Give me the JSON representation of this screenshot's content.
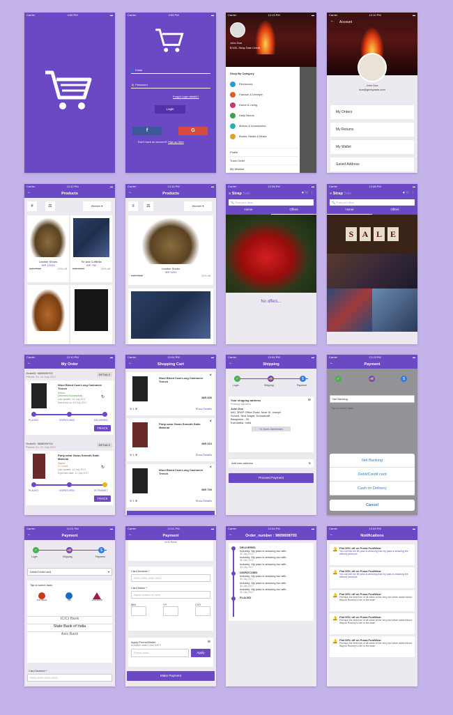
{
  "status": {
    "carrier": "Carrier",
    "time1": "4:55 PM",
    "time2": "12:10 PM",
    "time3": "12:08 PM",
    "time4": "12:13 PM",
    "time5": "12:09 PM",
    "time6": "12:04 PM",
    "time7": "12:01 PM"
  },
  "login": {
    "email": "Email",
    "password": "Password",
    "forgot": "Forgot Login details?",
    "login": "Login",
    "no_account": "Don't have an account?",
    "signup": "Sign up here",
    "fb": "f",
    "google": "G"
  },
  "drawer": {
    "user": "John Doe",
    "points": "$ 000, Strap Sale Credit",
    "section": "Shop By Category",
    "cats": [
      "Electronics",
      "Fashion & Lifestyle",
      "Home & Living",
      "Daily Needs",
      "Motors & Accessories",
      "Books, Media & Music"
    ],
    "links": [
      "Profile",
      "Track Order",
      "My Wishlist"
    ]
  },
  "account": {
    "title": "Account",
    "name": "John Doe",
    "email": "doe@geekyants.com",
    "items": [
      "My Orders",
      "My Returns",
      "My Wallet",
      "Saved Address"
    ]
  },
  "products": {
    "title": "Products",
    "filter": "Women",
    "p1_name": "Leather Shoes",
    "p1_price": "INR 12000",
    "p1_old": "INR 7560",
    "p1_off": "20% off",
    "p2_name": "Tie and Cufflinks",
    "p2_price": "INR 780",
    "p2_old": "INR 1200",
    "p2_off": "20% off",
    "l_name": "Leather Shoes",
    "l_price": "INR 5200",
    "l_old": "INR 7560",
    "l_off": "20% off"
  },
  "home": {
    "brand": "Strap",
    "brand2": "Sale",
    "search": "Find your deal",
    "tab1": "Home",
    "tab2": "Offers",
    "no_offers": "No offers...",
    "sale": [
      "S",
      "A",
      "L",
      "E"
    ]
  },
  "orders": {
    "title": "My Order",
    "o1_id": "OrderID: 9809500703",
    "o1_date": "Placed On: 14 July 2017",
    "details": "DETAILS",
    "o1_item": "Wool Blend Coat Long Cashmere Trench",
    "o1_status": "Status:",
    "o1_state": "Delivered Successfully",
    "o1_upd": "Last update: 14 July 2017",
    "o1_del": "Delivered on: 15 July 2017",
    "steps": [
      "PLACED",
      "DISPATCHED",
      "DELIVERED"
    ],
    "track": "TRACK",
    "o2_id": "OrderID: 9808009704",
    "o2_date": "Placed On: 10 July 2017",
    "o2_item": "Party-wear Gown Smooth Satin Material",
    "o2_state": "In Transit",
    "o2_upd": "Last update: 14 July 2017",
    "o2_del": "Expected date: 21 July 2017",
    "steps2": [
      "PLACED",
      "DISPATCHED",
      "IN TRANSIT"
    ]
  },
  "cart": {
    "title": "Shopping Cart",
    "c1": "Wool Blend Coat Long Cashmere Trench",
    "c1_price": "INR 600",
    "c2": "Party-wear Gown Smooth Satin Material",
    "c2_price": "INR 610",
    "c3": "Wool Blend Coat Long Cashmere Trench",
    "c3_price": "INR 700",
    "qty": "1",
    "show": "Show Details"
  },
  "shipping": {
    "title": "Shipping",
    "steps": [
      "Login",
      "Shipping",
      "Payment"
    ],
    "addr_title": "Your shipping address",
    "addr_sub": "Primary address",
    "addr_name": "John Doe",
    "addr": "#60, 3RAP Office Road, Near St. Joseph School, Nkst Nagar, Domashalli",
    "city": "Bangalore - 00",
    "state": "Karnataka, India",
    "more": "+2 More Addresses",
    "add": "Add new address",
    "proceed": "Proceed Payment"
  },
  "payment_sheet": {
    "title": "Payment",
    "method": "Net Banking",
    "tap": "Tap to select bank",
    "banks": [
      "ICICI Bank",
      "State Bank of India",
      "Axis Bank"
    ],
    "opts": [
      "Net Banking",
      "Debit/Credit card",
      "Cash on Delivery"
    ],
    "cancel": "Cancel"
  },
  "payment": {
    "title": "Payment",
    "method": "Debit/Credit card",
    "tap": "Tap to select bank",
    "bank_logos": [
      "ICICI Bank",
      "SBI",
      "AXIS BANK"
    ],
    "banks": [
      "ICICI Bank",
      "State Bank of India",
      "Axis Bank"
    ],
    "card_number": "Card Number *",
    "card_ph": "0000-0000-0000-0000"
  },
  "payment2": {
    "title": "Payment",
    "axis": "Axis Bank",
    "card_number": "Card Number *",
    "card_ph": "0000-0000-0000-0000",
    "card_name": "Card Name *",
    "name_ph": "Name written on card",
    "mm": "MM",
    "yy": "YY",
    "cvv": "CVV",
    "promo": "Apply Promo/Wallet",
    "promo_sub": "Available wallet Cash INR 0",
    "promo_ph": "Promo code",
    "apply": "Apply",
    "make": "Make Payment"
  },
  "ordnum": {
    "title": "Order_number : 9809608703",
    "s1": "DELIVERED",
    "s2": "DISPATCHED",
    "s3": "PLACED",
    "line": "Industry: My pass is amazing too with.",
    "date": "30 July 2017"
  },
  "notif": {
    "title": "Notifications",
    "head": "Flat 50% off on Puma FootWear",
    "t1": "You can tell me fie pass is amazing fust my pass is amazing fee without pressure",
    "t2": "Perhaps the best line of all came at the very end when asked about Wayne Rooney's role in the team"
  },
  "colors": {
    "primary": "#6b48c4",
    "bg": "#c4b3e8"
  }
}
